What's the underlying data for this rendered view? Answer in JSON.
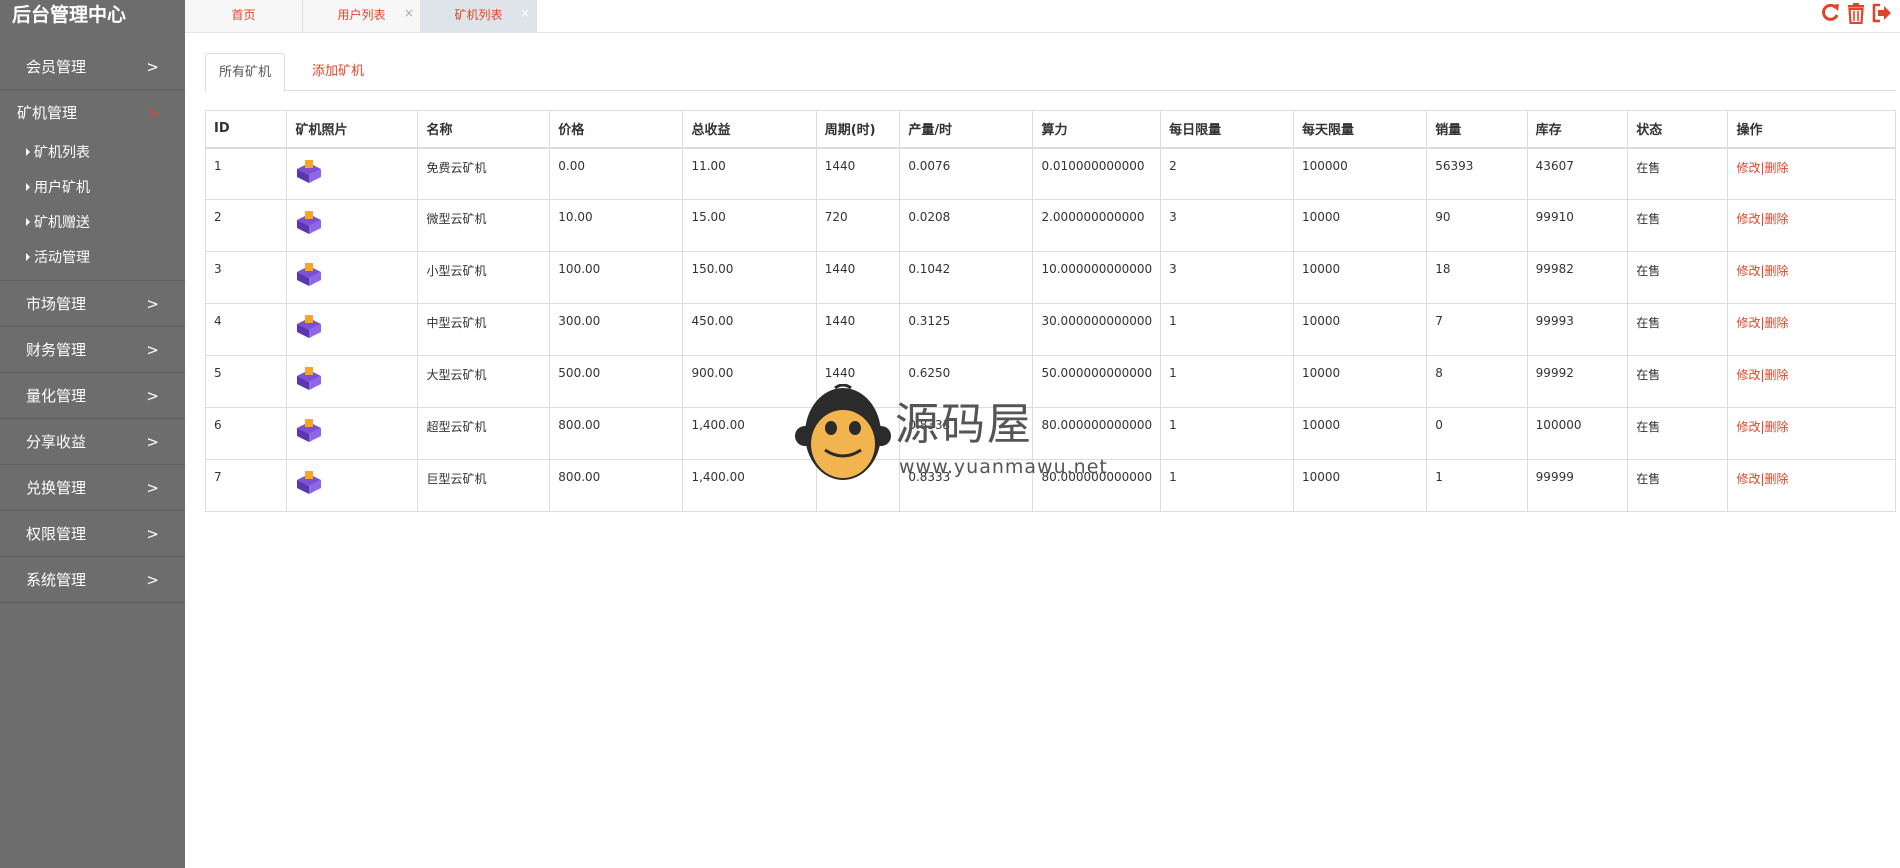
{
  "sidebar": {
    "title": "后台管理中心",
    "menu": [
      {
        "label": "会员管理",
        "open": false
      },
      {
        "label": "矿机管理",
        "open": true,
        "children": [
          "矿机列表",
          "用户矿机",
          "矿机赠送",
          "活动管理"
        ]
      },
      {
        "label": "市场管理",
        "open": false
      },
      {
        "label": "财务管理",
        "open": false
      },
      {
        "label": "量化管理",
        "open": false
      },
      {
        "label": "分享收益",
        "open": false
      },
      {
        "label": "兑换管理",
        "open": false
      },
      {
        "label": "权限管理",
        "open": false
      },
      {
        "label": "系统管理",
        "open": false
      }
    ],
    "chevron": ">"
  },
  "tabs": [
    {
      "label": "首页",
      "closable": false,
      "active": false
    },
    {
      "label": "用户列表",
      "closable": true,
      "active": false
    },
    {
      "label": "矿机列表",
      "closable": true,
      "active": true
    }
  ],
  "tab_close_glyph": "×",
  "top_icons": [
    "refresh-icon",
    "trash-icon",
    "logout-icon"
  ],
  "subtabs": {
    "all": "所有矿机",
    "add": "添加矿机"
  },
  "table": {
    "headers": [
      "ID",
      "矿机照片",
      "名称",
      "价格",
      "总收益",
      "周期(时)",
      "产量/时",
      "算力",
      "每日限量",
      "每天限量",
      "销量",
      "库存",
      "状态",
      "操作"
    ],
    "rows": [
      {
        "id": "1",
        "name": "免费云矿机",
        "price": "0.00",
        "total": "11.00",
        "cycle": "1440",
        "output": "0.0076",
        "power": "0.010000000000",
        "daily": "2",
        "perday": "100000",
        "sales": "56393",
        "stock": "43607",
        "status": "在售"
      },
      {
        "id": "2",
        "name": "微型云矿机",
        "price": "10.00",
        "total": "15.00",
        "cycle": "720",
        "output": "0.0208",
        "power": "2.000000000000",
        "daily": "3",
        "perday": "10000",
        "sales": "90",
        "stock": "99910",
        "status": "在售"
      },
      {
        "id": "3",
        "name": "小型云矿机",
        "price": "100.00",
        "total": "150.00",
        "cycle": "1440",
        "output": "0.1042",
        "power": "10.000000000000",
        "daily": "3",
        "perday": "10000",
        "sales": "18",
        "stock": "99982",
        "status": "在售"
      },
      {
        "id": "4",
        "name": "中型云矿机",
        "price": "300.00",
        "total": "450.00",
        "cycle": "1440",
        "output": "0.3125",
        "power": "30.000000000000",
        "daily": "1",
        "perday": "10000",
        "sales": "7",
        "stock": "99993",
        "status": "在售"
      },
      {
        "id": "5",
        "name": "大型云矿机",
        "price": "500.00",
        "total": "900.00",
        "cycle": "1440",
        "output": "0.6250",
        "power": "50.000000000000",
        "daily": "1",
        "perday": "10000",
        "sales": "8",
        "stock": "99992",
        "status": "在售"
      },
      {
        "id": "6",
        "name": "超型云矿机",
        "price": "800.00",
        "total": "1,400.00",
        "cycle": "",
        "output": "0.8333",
        "power": "80.000000000000",
        "daily": "1",
        "perday": "10000",
        "sales": "0",
        "stock": "100000",
        "status": "在售"
      },
      {
        "id": "7",
        "name": "巨型云矿机",
        "price": "800.00",
        "total": "1,400.00",
        "cycle": "",
        "output": "0.8333",
        "power": "80.000000000000",
        "daily": "1",
        "perday": "10000",
        "sales": "1",
        "stock": "99999",
        "status": "在售"
      }
    ],
    "edit_label": "修改|",
    "delete_label": "删除"
  },
  "watermark": {
    "text": "源码屋",
    "url": "www.yuanmawu.net"
  },
  "colors": {
    "sidebar_bg": "#6d6d6d",
    "accent": "#e0452a",
    "miner_purple": "#7b4fd6",
    "miner_orange": "#f5a623"
  }
}
